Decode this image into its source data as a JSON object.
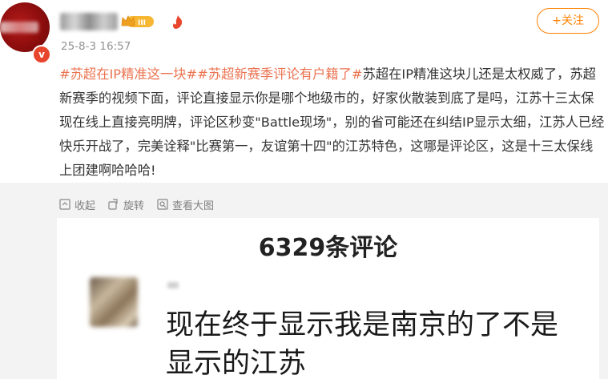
{
  "post": {
    "timestamp": "25-8-3 16:57",
    "follow_label": "+关注",
    "verified_mark": "v",
    "level_badge": "III",
    "hashtag1": "#苏超在IP精准这一块#",
    "hashtag2": "#苏超新赛季评论有户籍了#",
    "body": "苏超在IP精准这块儿还是太权威了，苏超新赛季的视频下面，评论直接显示你是哪个地级市的，好家伙散装到底了是吗，江苏十三太保现在线上直接亮明牌，评论区秒变\"Battle现场\"，别的省可能还在纠结IP显示太细，江苏人已经快乐开战了，完美诠释\"比赛第一，友谊第十四\"的江苏特色，这哪是评论区，这是十三太保线上团建啊哈哈哈!"
  },
  "toolbar": {
    "collapse_label": "收起",
    "rotate_label": "旋转",
    "view_large_label": "查看大图"
  },
  "image": {
    "comment_count": "6329条评论",
    "comment_text": "现在终于显示我是南京的了不是显示的江苏"
  },
  "colors": {
    "accent": "#ff8200",
    "hashtag": "#eb7350",
    "muted": "#939393"
  },
  "icons": [
    "collapse-icon",
    "rotate-icon",
    "zoom-icon",
    "crown-badge-icon",
    "fire-icon",
    "verified-icon"
  ]
}
